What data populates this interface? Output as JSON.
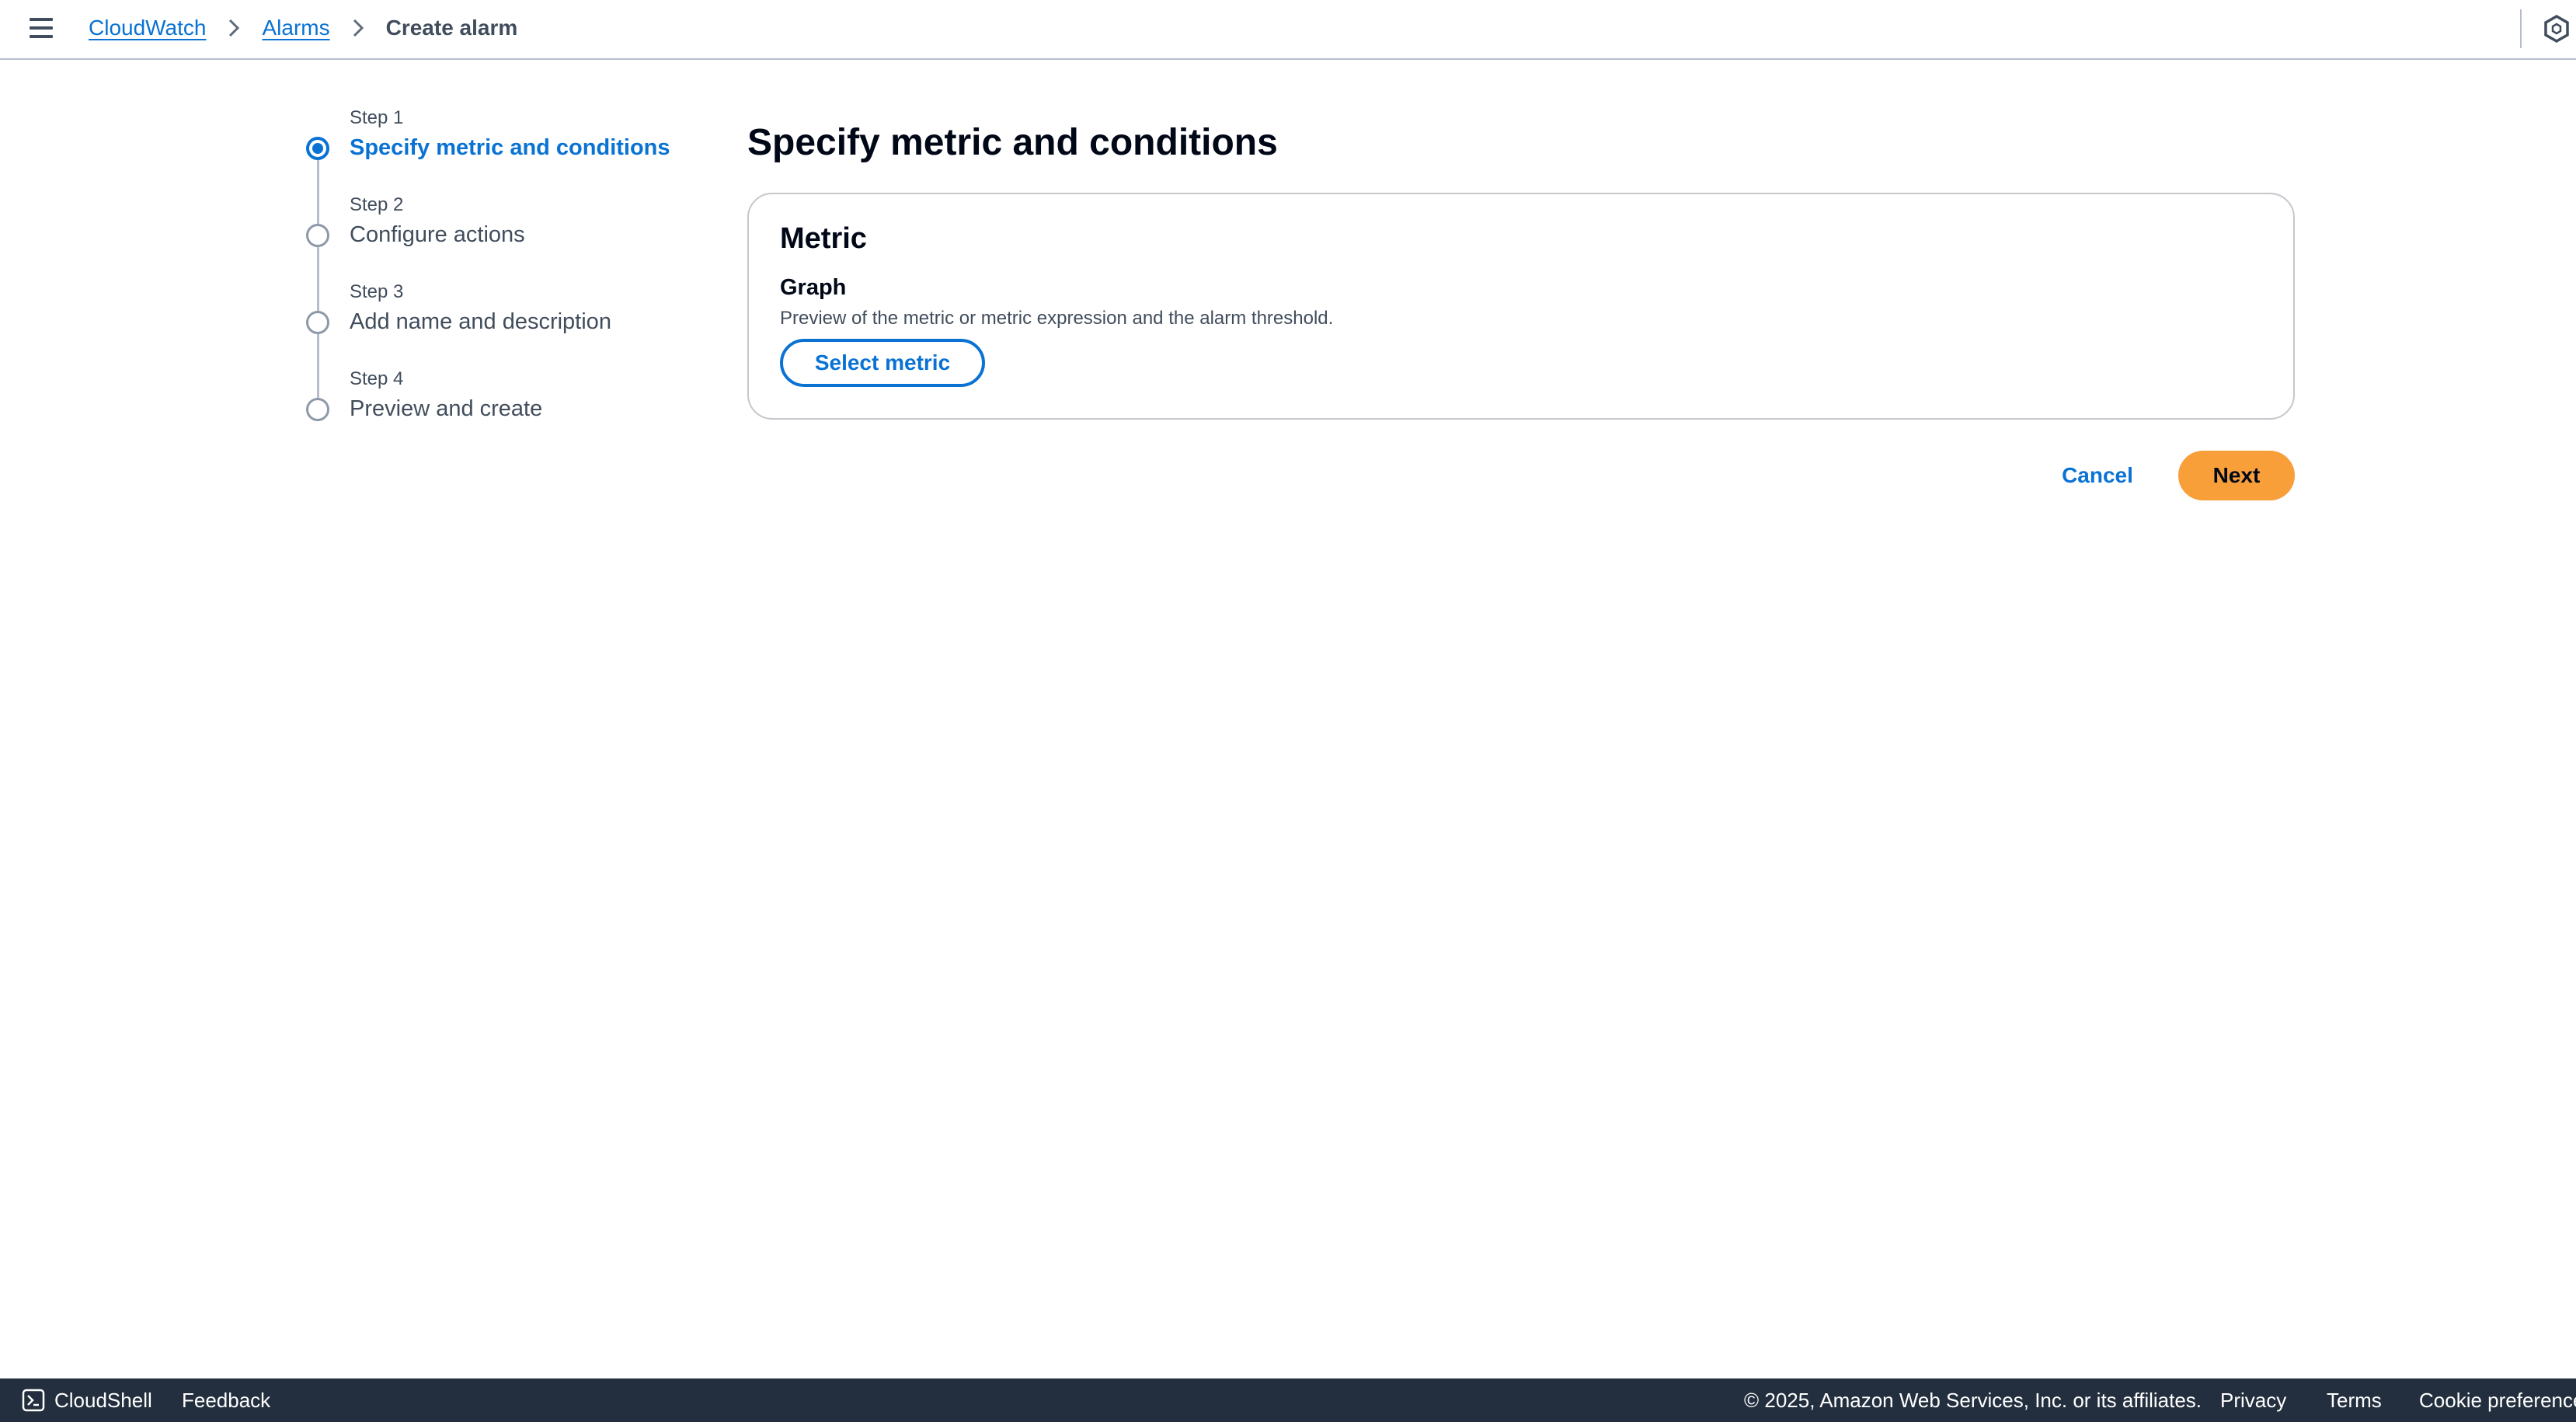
{
  "breadcrumb": {
    "items": [
      "CloudWatch",
      "Alarms"
    ],
    "current": "Create alarm"
  },
  "wizard": {
    "steps": [
      {
        "number": "Step 1",
        "title": "Specify metric and conditions",
        "active": true
      },
      {
        "number": "Step 2",
        "title": "Configure actions",
        "active": false
      },
      {
        "number": "Step 3",
        "title": "Add name and description",
        "active": false
      },
      {
        "number": "Step 4",
        "title": "Preview and create",
        "active": false
      }
    ]
  },
  "main": {
    "title": "Specify metric and conditions",
    "card": {
      "title": "Metric",
      "graph_label": "Graph",
      "graph_description": "Preview of the metric or metric expression and the alarm threshold.",
      "select_button": "Select metric"
    },
    "cancel_label": "Cancel",
    "next_label": "Next"
  },
  "footer": {
    "cloudshell": "CloudShell",
    "feedback": "Feedback",
    "copyright": "© 2025, Amazon Web Services, Inc. or its affiliates.",
    "privacy": "Privacy",
    "terms": "Terms",
    "cookie": "Cookie preferences"
  },
  "colors": {
    "link": "#0972d3",
    "primary_button": "#f89f3a",
    "footer_bg": "#232f3e",
    "text": "#000716",
    "secondary_text": "#414d5c"
  },
  "icons": {
    "menu": "hamburger-menu-icon",
    "separator": "chevron-right-icon",
    "top_right": "hexagon-icon",
    "cloudshell": "terminal-icon"
  }
}
